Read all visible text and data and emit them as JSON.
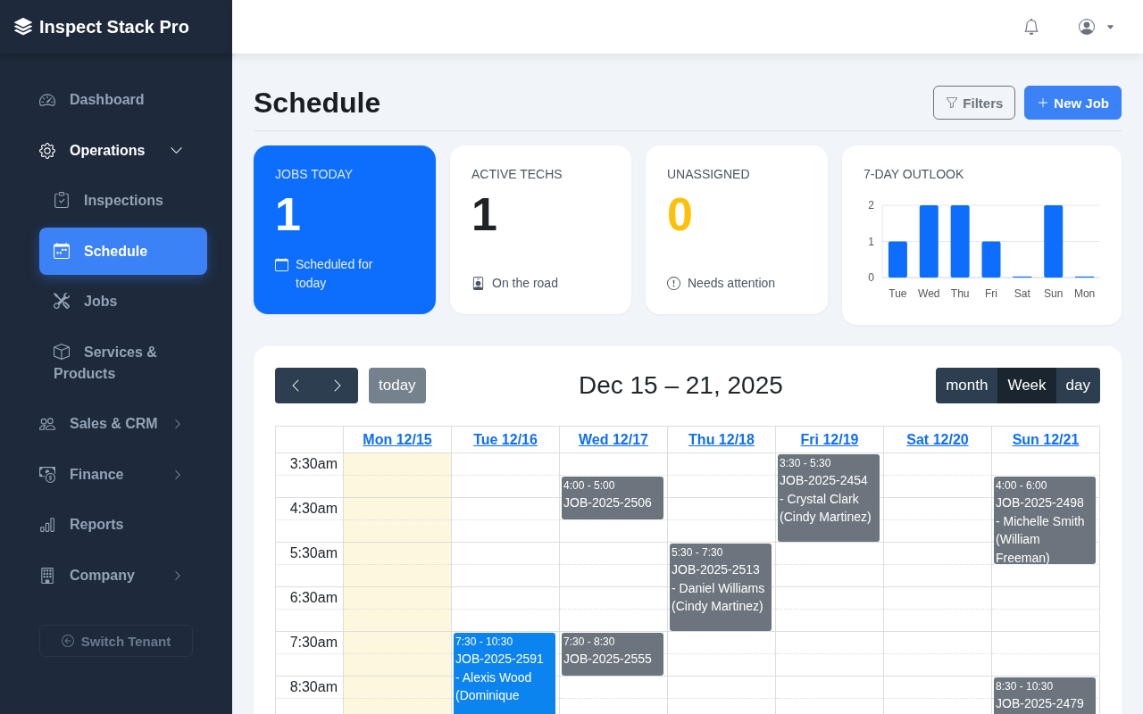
{
  "brand": {
    "name": "Inspect Stack Pro"
  },
  "sidebar": {
    "items": [
      {
        "label": "Dashboard",
        "kind": "link",
        "selected": false
      },
      {
        "label": "Operations",
        "kind": "group",
        "expanded": true,
        "selected": false,
        "children": [
          {
            "label": "Inspections",
            "selected": false
          },
          {
            "label": "Schedule",
            "selected": true
          },
          {
            "label": "Jobs",
            "selected": false
          },
          {
            "label": "Services & Products",
            "selected": false
          }
        ]
      },
      {
        "label": "Sales & CRM",
        "kind": "group",
        "expanded": false,
        "selected": false
      },
      {
        "label": "Finance",
        "kind": "group",
        "expanded": false,
        "selected": false
      },
      {
        "label": "Reports",
        "kind": "link",
        "selected": false
      },
      {
        "label": "Company",
        "kind": "group",
        "expanded": false,
        "selected": false
      }
    ],
    "switch_tenant": {
      "label": "Switch Tenant",
      "disabled": true
    }
  },
  "page": {
    "title": "Schedule",
    "actions": [
      {
        "label": "Filters",
        "kind": "outline"
      },
      {
        "label": "New Job",
        "kind": "primary"
      }
    ]
  },
  "stats": [
    {
      "label": "JOBS TODAY",
      "value": "1",
      "note": "Scheduled for today",
      "kind": "primary"
    },
    {
      "label": "ACTIVE TECHS",
      "value": "1",
      "note": "On the road",
      "kind": "plain"
    },
    {
      "label": "UNASSIGNED",
      "value": "0",
      "note": "Needs attention",
      "kind": "warning"
    }
  ],
  "outlook": {
    "title": "7-DAY OUTLOOK",
    "chart_data": {
      "type": "bar",
      "categories": [
        "Tue",
        "Wed",
        "Thu",
        "Fri",
        "Sat",
        "Sun",
        "Mon"
      ],
      "values": [
        1,
        2,
        2,
        1,
        0,
        2,
        0
      ],
      "ylim": [
        0,
        2
      ],
      "yticks": [
        0,
        1,
        2
      ]
    }
  },
  "calendar": {
    "today_button": {
      "label": "today",
      "disabled": true
    },
    "title": "Dec 15 – 21, 2025",
    "views": [
      {
        "label": "month",
        "selected": false
      },
      {
        "label": "Week",
        "selected": true
      },
      {
        "label": "day",
        "selected": false
      }
    ],
    "time_labels": [
      "3:30am",
      "4:30am",
      "5:30am",
      "6:30am",
      "7:30am",
      "8:30am"
    ],
    "days": [
      {
        "label": "Mon 12/15",
        "today": true
      },
      {
        "label": "Tue 12/16",
        "today": false,
        "events": [
          {
            "time": "7:30 - 10:30",
            "job": "JOB-2025-2591",
            "detail": "- Alexis Wood (Dominique",
            "color": "#0b84f0"
          }
        ]
      },
      {
        "label": "Wed 12/17",
        "today": false,
        "events": [
          {
            "time": "4:00 - 5:00",
            "job": "JOB-2025-2506",
            "color": "#6c757d"
          },
          {
            "time": "7:30 - 8:30",
            "job": "JOB-2025-2555",
            "color": "#6c757d"
          }
        ]
      },
      {
        "label": "Thu 12/18",
        "today": false,
        "events": [
          {
            "time": "5:30 - 7:30",
            "job": "JOB-2025-2513",
            "detail": "- Daniel Williams (Cindy Martinez)",
            "color": "#6c757d"
          }
        ]
      },
      {
        "label": "Fri 12/19",
        "today": false,
        "events": [
          {
            "time": "3:30 - 5:30",
            "job": "JOB-2025-2454",
            "detail": "- Crystal Clark (Cindy Martinez)",
            "color": "#6c757d"
          }
        ]
      },
      {
        "label": "Sat 12/20",
        "today": false
      },
      {
        "label": "Sun 12/21",
        "today": false,
        "events": [
          {
            "time": "4:00 - 6:00",
            "job": "JOB-2025-2498",
            "detail": "- Michelle Smith (William Freeman)",
            "color": "#6c757d"
          },
          {
            "time": "8:30 - 10:30",
            "job": "JOB-2025-2479",
            "color": "#6c757d"
          }
        ]
      }
    ]
  }
}
